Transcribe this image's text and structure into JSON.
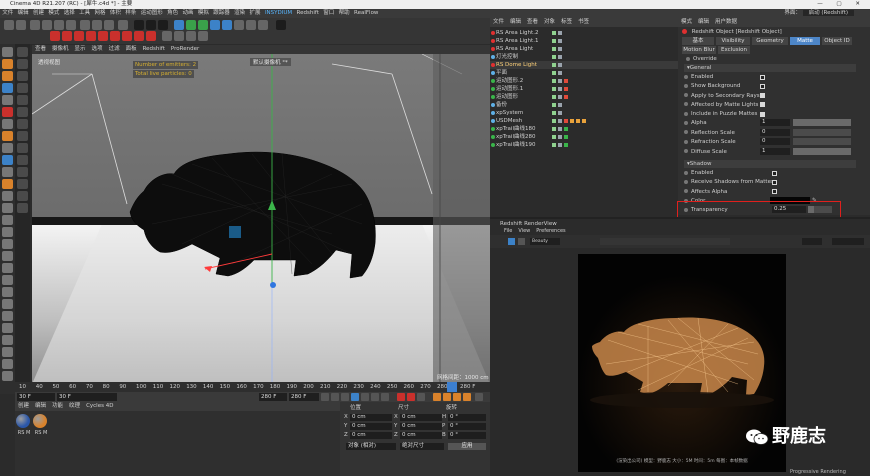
{
  "window": {
    "title": "Cinema 4D R21.207 (RC) - [犀牛.c4d *] - 主要"
  },
  "menubar": {
    "items": [
      "文件",
      "编辑",
      "创建",
      "模式",
      "选择",
      "工具",
      "网格",
      "体积",
      "样条",
      "运动图形",
      "角色",
      "动画",
      "模拟",
      "跟踪器",
      "渲染",
      "扩展",
      "INSYDIUM",
      "Redshift",
      "窗口",
      "帮助",
      "RealFlow"
    ],
    "highlight_index": 16,
    "layout_label": "界面：",
    "layout_value": "启动 (Redshift)"
  },
  "viewport": {
    "menu": [
      "查看",
      "摄像机",
      "显示",
      "选项",
      "过滤",
      "面板",
      "Redshift",
      "ProRender"
    ],
    "camera_label": "透视视图",
    "hud_emitters": "Number of emitters: 2",
    "hud_particles": "Total live particles: 0",
    "camera_tag": "默认摄像机 °*",
    "grid_spacing": "网格间距：1000 cm"
  },
  "timeline": {
    "ticks": [
      "10",
      "40",
      "50",
      "60",
      "70",
      "80",
      "90",
      "100",
      "110",
      "120",
      "130",
      "140",
      "150",
      "160",
      "170",
      "180",
      "190",
      "200",
      "210",
      "220",
      "230",
      "240",
      "250",
      "260",
      "270",
      "280"
    ],
    "end_label": "280 F",
    "start_frame": "30 F",
    "current_frame": "30 F",
    "end_frame_a": "280 F",
    "end_frame_b": "280 F"
  },
  "material_manager": {
    "menu": [
      "创建",
      "编辑",
      "功能",
      "纹理",
      "Cycles 4D"
    ],
    "materials": [
      {
        "label": "RS M",
        "color": "#2a56a8"
      },
      {
        "label": "RS M",
        "color": "#d9822b"
      }
    ]
  },
  "coordinates": {
    "headers": [
      "位置",
      "尺寸",
      "旋转"
    ],
    "rows": [
      {
        "axis": "X",
        "pos": "0 cm",
        "size_axis": "X",
        "size": "0 cm",
        "rot_axis": "H",
        "rot": "0 °"
      },
      {
        "axis": "Y",
        "pos": "0 cm",
        "size_axis": "Y",
        "size": "0 cm",
        "rot_axis": "P",
        "rot": "0 °"
      },
      {
        "axis": "Z",
        "pos": "0 cm",
        "size_axis": "Z",
        "size": "0 cm",
        "rot_axis": "B",
        "rot": "0 °"
      }
    ],
    "mode_object": "对象 (相对)",
    "mode_size": "绝对尺寸",
    "apply": "应用"
  },
  "object_manager": {
    "tabs": [
      "文件",
      "编辑",
      "查看",
      "对象",
      "标签",
      "书签"
    ],
    "rows": [
      {
        "name": "RS Area Light.2",
        "color": "#e03030"
      },
      {
        "name": "RS Area Light.1",
        "color": "#e03030"
      },
      {
        "name": "RS Area Light",
        "color": "#e03030"
      },
      {
        "name": "灯光控制",
        "color": "#5fb0e6"
      },
      {
        "name": "RS Dome Light",
        "color": "#e03030"
      },
      {
        "name": "平面",
        "color": "#5fb0e6"
      },
      {
        "name": "运动图形.2",
        "color": "#39b54a"
      },
      {
        "name": "运动图形.1",
        "color": "#39b54a"
      },
      {
        "name": "运动图形",
        "color": "#39b54a"
      },
      {
        "name": "备份",
        "color": "#5fb0e6"
      },
      {
        "name": "xpSystem",
        "color": "#5fb0e6"
      },
      {
        "name": "USDMesh",
        "color": "#5fb0e6"
      },
      {
        "name": "xpTrail曲线180",
        "color": "#39b54a"
      },
      {
        "name": "xpTrail曲线280",
        "color": "#39b54a"
      },
      {
        "name": "xpTrail曲线190",
        "color": "#39b54a"
      }
    ]
  },
  "attributes": {
    "header_tabs": [
      "模式",
      "编辑",
      "用户数据"
    ],
    "object_title": "Redshift Object [Redshift Object]",
    "tabs": [
      "基本",
      "Visibility",
      "Geometry",
      "Matte",
      "Object ID",
      "Motion Blur",
      "Exclusion"
    ],
    "active_tab": "Matte",
    "override": "Override",
    "general_header": "General",
    "general_params": [
      {
        "label": "Enabled",
        "checked": true
      },
      {
        "label": "Show Background",
        "checked": true
      },
      {
        "label": "Apply to Secondary Rays",
        "checked": false
      },
      {
        "label": "Affected by Matte Lights",
        "checked": false
      },
      {
        "label": "Include in Puzzle Mattes",
        "checked": false
      }
    ],
    "numeric_params": [
      {
        "label": "Alpha",
        "value": "1",
        "level": 1.0
      },
      {
        "label": "Reflection Scale",
        "value": "0",
        "level": 0.0
      },
      {
        "label": "Refraction Scale",
        "value": "0",
        "level": 0.0
      },
      {
        "label": "Diffuse Scale",
        "value": "1",
        "level": 1.0
      }
    ],
    "shadow_header": "Shadow",
    "shadow_params": [
      {
        "label": "Enabled",
        "checked": true
      },
      {
        "label": "Receive Shadows from Mattes",
        "checked": true
      },
      {
        "label": "Affects Alpha",
        "checked": true
      }
    ],
    "color_label": "Color",
    "transparency_label": "Transparency",
    "transparency_value": "0.25",
    "transparency_level": 0.25
  },
  "render_view": {
    "title": "Redshift RenderView",
    "menu": [
      "File",
      "View",
      "Preferences"
    ],
    "beauty": "Beauty",
    "caption": "(渲染出公司) 模型：野鹿志 大小：5M 时间：5m 每图：本帧数据",
    "status": "Progressive Rendering"
  },
  "watermark": {
    "text": "野鹿志"
  }
}
